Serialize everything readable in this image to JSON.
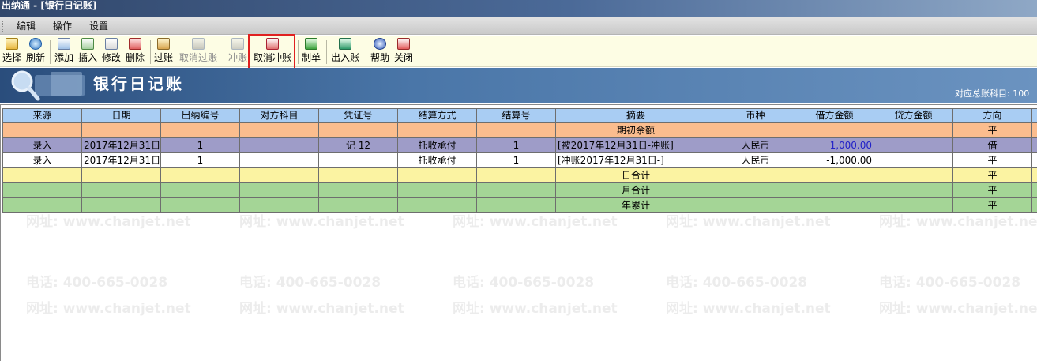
{
  "window": {
    "title": "出纳通 - [银行日记账]"
  },
  "menu": {
    "items": [
      "编辑",
      "操作",
      "设置"
    ]
  },
  "toolbar": {
    "buttons": [
      {
        "label": "选择",
        "icon": "select-icon",
        "enabled": true
      },
      {
        "label": "刷新",
        "icon": "refresh-icon",
        "enabled": true
      },
      {
        "label": "添加",
        "icon": "add-icon",
        "enabled": true
      },
      {
        "label": "插入",
        "icon": "insert-icon",
        "enabled": true
      },
      {
        "label": "修改",
        "icon": "edit-icon",
        "enabled": true
      },
      {
        "label": "删除",
        "icon": "delete-icon",
        "enabled": true
      },
      {
        "label": "过账",
        "icon": "post-icon",
        "enabled": true
      },
      {
        "label": "取消过账",
        "icon": "cancel-post-icon",
        "enabled": false
      },
      {
        "label": "冲账",
        "icon": "reverse-icon",
        "enabled": false
      },
      {
        "label": "取消冲账",
        "icon": "cancel-reverse-icon",
        "enabled": true,
        "highlighted": true
      },
      {
        "label": "制单",
        "icon": "voucher-icon",
        "enabled": true
      },
      {
        "label": "出入账",
        "icon": "in-out-icon",
        "enabled": true
      },
      {
        "label": "帮助",
        "icon": "help-icon",
        "enabled": true
      },
      {
        "label": "关闭",
        "icon": "close-icon",
        "enabled": true
      }
    ]
  },
  "banner": {
    "title": "银行日记账",
    "info": "对应总账科目: 100"
  },
  "ledger": {
    "columns": [
      "来源",
      "日期",
      "出纳编号",
      "对方科目",
      "凭证号",
      "结算方式",
      "结算号",
      "摘要",
      "币种",
      "借方金额",
      "贷方金额",
      "方向"
    ],
    "opening": {
      "label": "期初余额",
      "direction": "平"
    },
    "entries": [
      {
        "source": "录入",
        "date": "2017年12月31日",
        "cashier_no": "1",
        "counter_account": "",
        "voucher_no": "记 12",
        "settlement": "托收承付",
        "settlement_no": "1",
        "summary": "[被2017年12月31日-冲账]",
        "currency": "人民币",
        "debit": "1,000.00",
        "credit": "",
        "direction": "借"
      },
      {
        "source": "录入",
        "date": "2017年12月31日",
        "cashier_no": "1",
        "counter_account": "",
        "voucher_no": "",
        "settlement": "托收承付",
        "settlement_no": "1",
        "summary": "[冲账2017年12月31日-]",
        "currency": "人民币",
        "debit": "-1,000.00",
        "credit": "",
        "direction": "平"
      }
    ],
    "totals": [
      {
        "label": "日合计",
        "direction": "平"
      },
      {
        "label": "月合计",
        "direction": "平"
      },
      {
        "label": "年累计",
        "direction": "平"
      }
    ]
  },
  "watermark": {
    "phone": "电话: 400-665-0028",
    "site": "网址: www.chanjet.net"
  },
  "colors": {
    "header": "#a9cdf3",
    "opening_row": "#fbbd8e",
    "reversed_row": "#9e9cc8",
    "day_total": "#fbf3a2",
    "month_year_total": "#a4d596",
    "highlight_box": "#e02020",
    "banner": "#4a76a8"
  }
}
